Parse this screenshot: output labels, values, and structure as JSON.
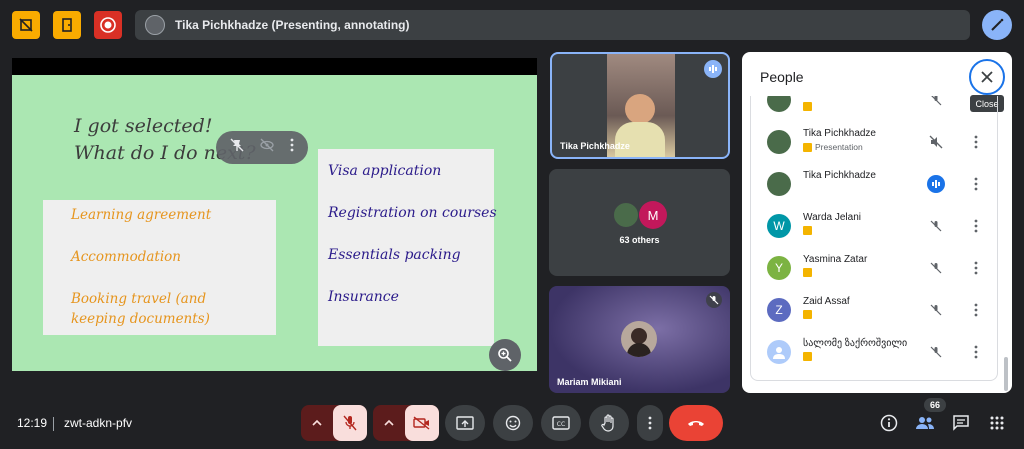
{
  "top_bar": {
    "presenter_label": "Tika Pichkhadze (Presenting, annotating)",
    "icons": [
      "pen-off-icon",
      "door-exit-icon",
      "record-icon",
      "annotate-pen-icon"
    ],
    "colors": {
      "yellow": "#f9ab00",
      "red": "#d93025",
      "accent": "#8ab4f8"
    }
  },
  "slide": {
    "title_line1": "I got selected!",
    "title_line2": "What do I do next?",
    "left_items": [
      "Learning agreement",
      "Accommodation",
      "Booking travel (and",
      "keeping documents)"
    ],
    "right_items": [
      "Visa application",
      "Registration on courses",
      "Essentials packing",
      "Insurance"
    ],
    "colors": {
      "background": "#abe7b2",
      "orange_text": "#e6951e",
      "purple_text": "#2a1a8a"
    }
  },
  "tiles": {
    "tile1_name": "Tika Pichkhadze",
    "tile2_avatar_letter": "M",
    "tile2_label": "63 others",
    "tile3_name": "Mariam Mikiani"
  },
  "people_panel": {
    "title": "People",
    "close_tooltip": "Close",
    "rows": [
      {
        "name": "",
        "subtitle": "",
        "avatar": "",
        "status": "mic-off"
      },
      {
        "name": "Tika Pichkhadze",
        "subtitle": "Presentation",
        "avatar": "",
        "status": "speaker-off"
      },
      {
        "name": "Tika Pichkhadze",
        "subtitle": "",
        "avatar": "",
        "status": "speaking"
      },
      {
        "name": "Warda Jelani",
        "subtitle": "",
        "avatar": "W",
        "avatar_color": "#0097a7",
        "status": "mic-off"
      },
      {
        "name": "Yasmina Zatar",
        "subtitle": "",
        "avatar": "Y",
        "avatar_color": "#7cb342",
        "status": "mic-off"
      },
      {
        "name": "Zaid Assaf",
        "subtitle": "",
        "avatar": "Z",
        "avatar_color": "#5c6bc0",
        "status": "mic-off"
      },
      {
        "name": "სალომე ზაქროშვილი",
        "subtitle": "",
        "avatar": "",
        "status": "mic-off"
      }
    ]
  },
  "bottom_bar": {
    "time": "12:19",
    "meeting_code": "zwt-adkn-pfv",
    "participant_count": "66"
  }
}
